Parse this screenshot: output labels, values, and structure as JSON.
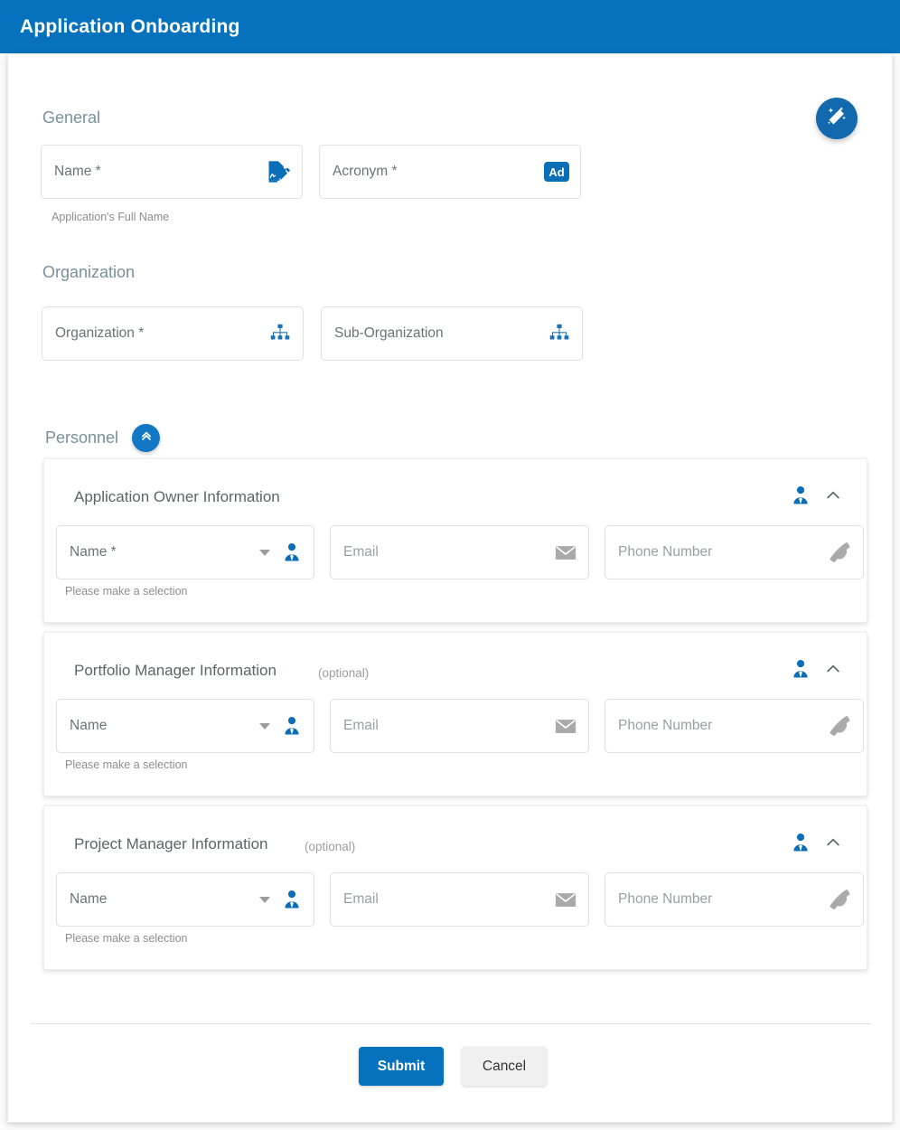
{
  "header": {
    "title": "Application Onboarding"
  },
  "fab": {
    "icon": "magic-wand-icon"
  },
  "general": {
    "heading": "General",
    "name_field": {
      "label": "Name *",
      "icon": "signature-document-icon"
    },
    "acronym_field": {
      "label": "Acronym *",
      "icon": "ad-badge-icon",
      "badge_text": "Ad"
    },
    "helper_text": "Application's Full Name"
  },
  "organization": {
    "heading": "Organization",
    "organization_field": {
      "label": "Organization *",
      "icon": "org-chart-icon"
    },
    "sub_organization_field": {
      "label": "Sub-Organization",
      "icon": "org-chart-icon"
    }
  },
  "personnel": {
    "heading": "Personnel",
    "toggle_icon": "double-chevron-up-icon",
    "cards": [
      {
        "title": "Application Owner Information",
        "optional": "",
        "person_icon": "business-person-icon",
        "collapse_icon": "chevron-up-icon",
        "name_field": {
          "label": "Name *",
          "icon": "business-person-icon",
          "caret": "dropdown-caret-icon"
        },
        "email_field": {
          "placeholder": "Email",
          "icon": "envelope-icon"
        },
        "phone_field": {
          "placeholder": "Phone Number",
          "icon": "phone-icon"
        },
        "helper_text": "Please make a selection"
      },
      {
        "title": "Portfolio Manager Information",
        "optional": "(optional)",
        "person_icon": "business-person-icon",
        "collapse_icon": "chevron-up-icon",
        "name_field": {
          "label": "Name",
          "icon": "business-person-icon",
          "caret": "dropdown-caret-icon"
        },
        "email_field": {
          "placeholder": "Email",
          "icon": "envelope-icon"
        },
        "phone_field": {
          "placeholder": "Phone Number",
          "icon": "phone-icon"
        },
        "helper_text": "Please make a selection"
      },
      {
        "title": "Project Manager Information",
        "optional": "(optional)",
        "person_icon": "business-person-icon",
        "collapse_icon": "chevron-up-icon",
        "name_field": {
          "label": "Name",
          "icon": "business-person-icon",
          "caret": "dropdown-caret-icon"
        },
        "email_field": {
          "placeholder": "Email",
          "icon": "envelope-icon"
        },
        "phone_field": {
          "placeholder": "Phone Number",
          "icon": "phone-icon"
        },
        "helper_text": "Please make a selection"
      }
    ]
  },
  "footer": {
    "submit_label": "Submit",
    "cancel_label": "Cancel"
  },
  "colors": {
    "brand_blue": "#0672bd",
    "icon_blue": "#1378c4",
    "heading_gray": "#78909c",
    "placeholder_gray": "#9aa0a6",
    "border_gray": "#e0e0e0"
  }
}
